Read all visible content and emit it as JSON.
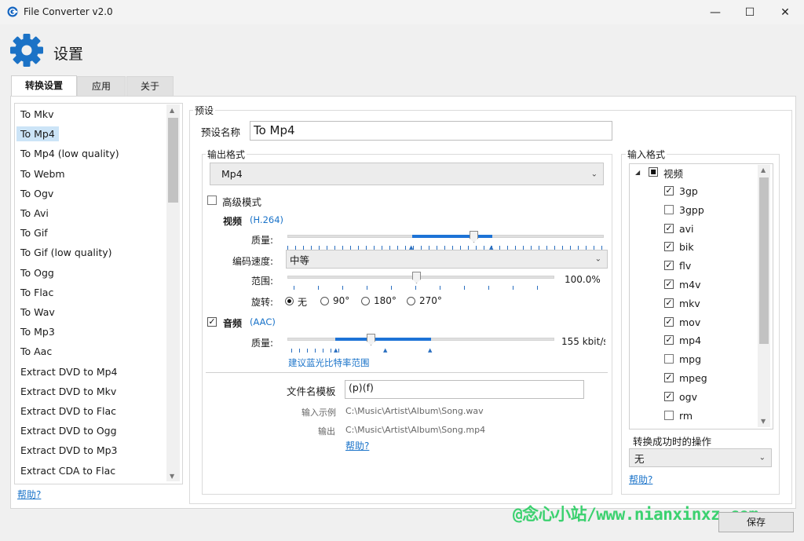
{
  "window": {
    "title": "File Converter v2.0",
    "minimize": "—",
    "maximize": "☐",
    "close": "✕"
  },
  "header": {
    "title": "设置"
  },
  "tabs": [
    {
      "label": "转换设置",
      "active": true
    },
    {
      "label": "应用",
      "active": false
    },
    {
      "label": "关于",
      "active": false
    }
  ],
  "presets": {
    "items": [
      "To Mkv",
      "To Mp4",
      "To Mp4 (low quality)",
      "To Webm",
      "To Ogv",
      "To Avi",
      "To Gif",
      "To Gif (low quality)",
      "To Ogg",
      "To Flac",
      "To Wav",
      "To Mp3",
      "To Aac",
      "Extract DVD to Mp4",
      "Extract DVD to Mkv",
      "Extract DVD to Flac",
      "Extract DVD to Ogg",
      "Extract DVD to Mp3",
      "Extract CDA to Flac"
    ],
    "selected_index": 1,
    "help_link": "帮助?"
  },
  "preset": {
    "group_label": "预设",
    "name_label": "预设名称",
    "name_value": "To Mp4",
    "output_group_label": "输出格式",
    "output_format": "Mp4",
    "advanced_label": "高级模式",
    "advanced_checked": false,
    "video": {
      "label": "视频",
      "codec": "(H.264)",
      "quality_label": "质量:",
      "quality_fraction": 0.59,
      "speed_label": "编码速度:",
      "speed_value": "中等",
      "scale_label": "范围:",
      "scale_value": "100.0%",
      "rotate_label": "旋转:",
      "rotations": [
        "无",
        "90°",
        "180°",
        "270°"
      ],
      "rotation_selected": 0
    },
    "audio": {
      "label": "音频",
      "codec": "(AAC)",
      "checked": true,
      "quality_label": "质量:",
      "quality_value": "155 kbit/s",
      "bluray_hint": "建议蓝光比特率范围"
    },
    "filename_label": "文件名模板",
    "filename_value": "(p)(f)",
    "input_example_label": "输入示例",
    "input_example": "C:\\Music\\Artist\\Album\\Song.wav",
    "output_example_label": "输出",
    "output_example": "C:\\Music\\Artist\\Album\\Song.mp4",
    "help_link": "帮助?"
  },
  "input_formats": {
    "group_label": "输入格式",
    "root_label": "视频",
    "items": [
      {
        "name": "3gp",
        "checked": true
      },
      {
        "name": "3gpp",
        "checked": false
      },
      {
        "name": "avi",
        "checked": true
      },
      {
        "name": "bik",
        "checked": true
      },
      {
        "name": "flv",
        "checked": true
      },
      {
        "name": "m4v",
        "checked": true
      },
      {
        "name": "mkv",
        "checked": true
      },
      {
        "name": "mov",
        "checked": true
      },
      {
        "name": "mp4",
        "checked": true
      },
      {
        "name": "mpg",
        "checked": false
      },
      {
        "name": "mpeg",
        "checked": true
      },
      {
        "name": "ogv",
        "checked": true
      },
      {
        "name": "rm",
        "checked": false
      }
    ],
    "on_success_label": "转换成功时的操作",
    "on_success_value": "无",
    "help_link": "帮助?"
  },
  "save_button": "保存",
  "watermark": "@念心小站/www.nianxinxz.com",
  "colors": {
    "accent": "#1d73d6",
    "gear": "#1b72c6",
    "watermark": "#3bd16f"
  }
}
